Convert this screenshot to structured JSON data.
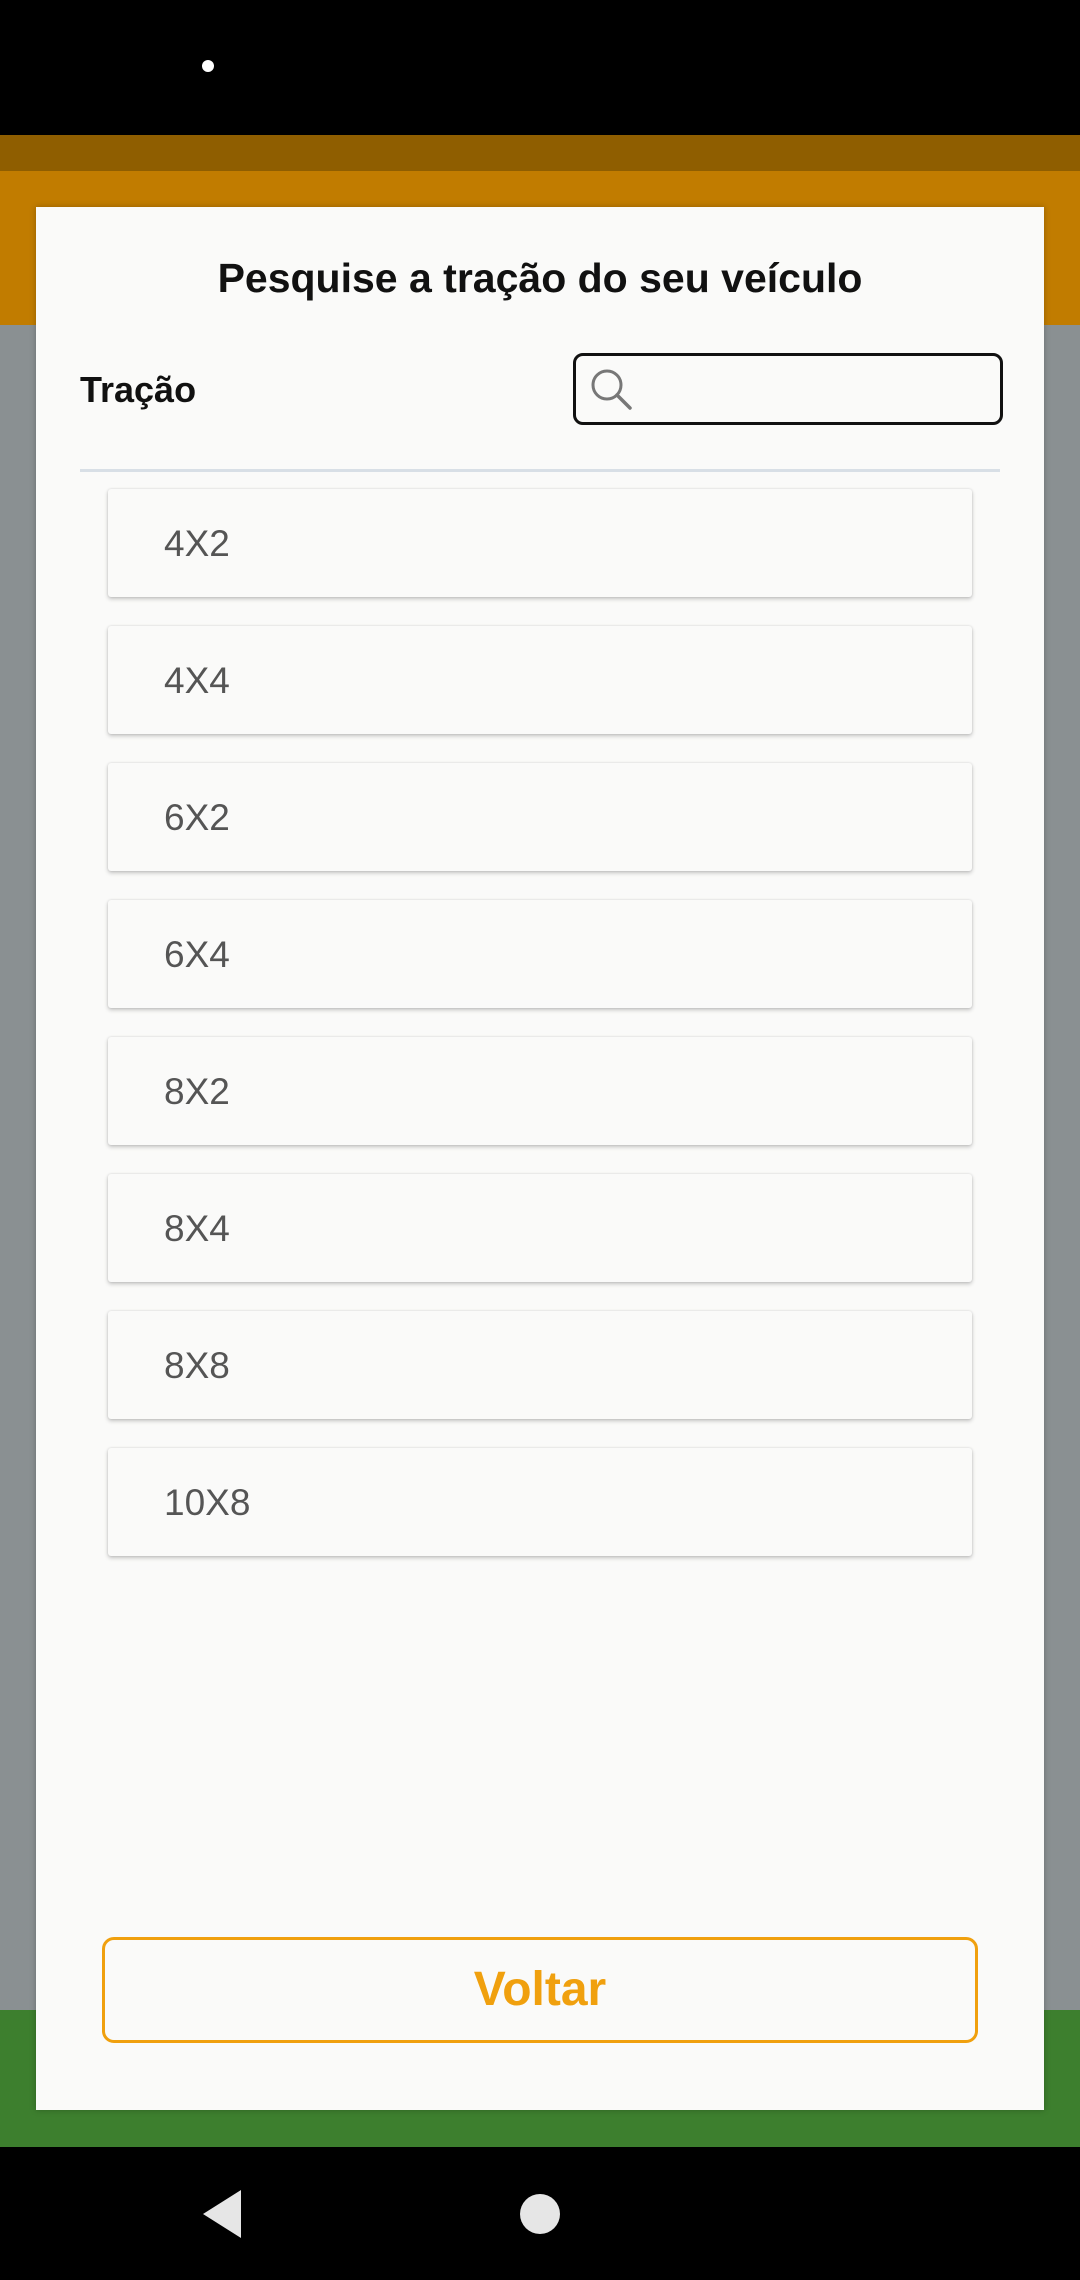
{
  "dialog": {
    "title": "Pesquise a tração do seu veículo",
    "field_label": "Tração",
    "search": {
      "value": "",
      "placeholder": ""
    },
    "options": [
      "4X2",
      "4X4",
      "6X2",
      "6X4",
      "8X2",
      "8X4",
      "8X8",
      "10X8"
    ],
    "back_label": "Voltar"
  },
  "icons": {
    "search": "search-icon",
    "nav_back": "nav-back-icon",
    "nav_home": "nav-home-icon"
  },
  "colors": {
    "accent": "#f0a00e",
    "appbar": "#c17c00",
    "green_bar": "#3d7f2e",
    "status_bar": "#000000"
  }
}
